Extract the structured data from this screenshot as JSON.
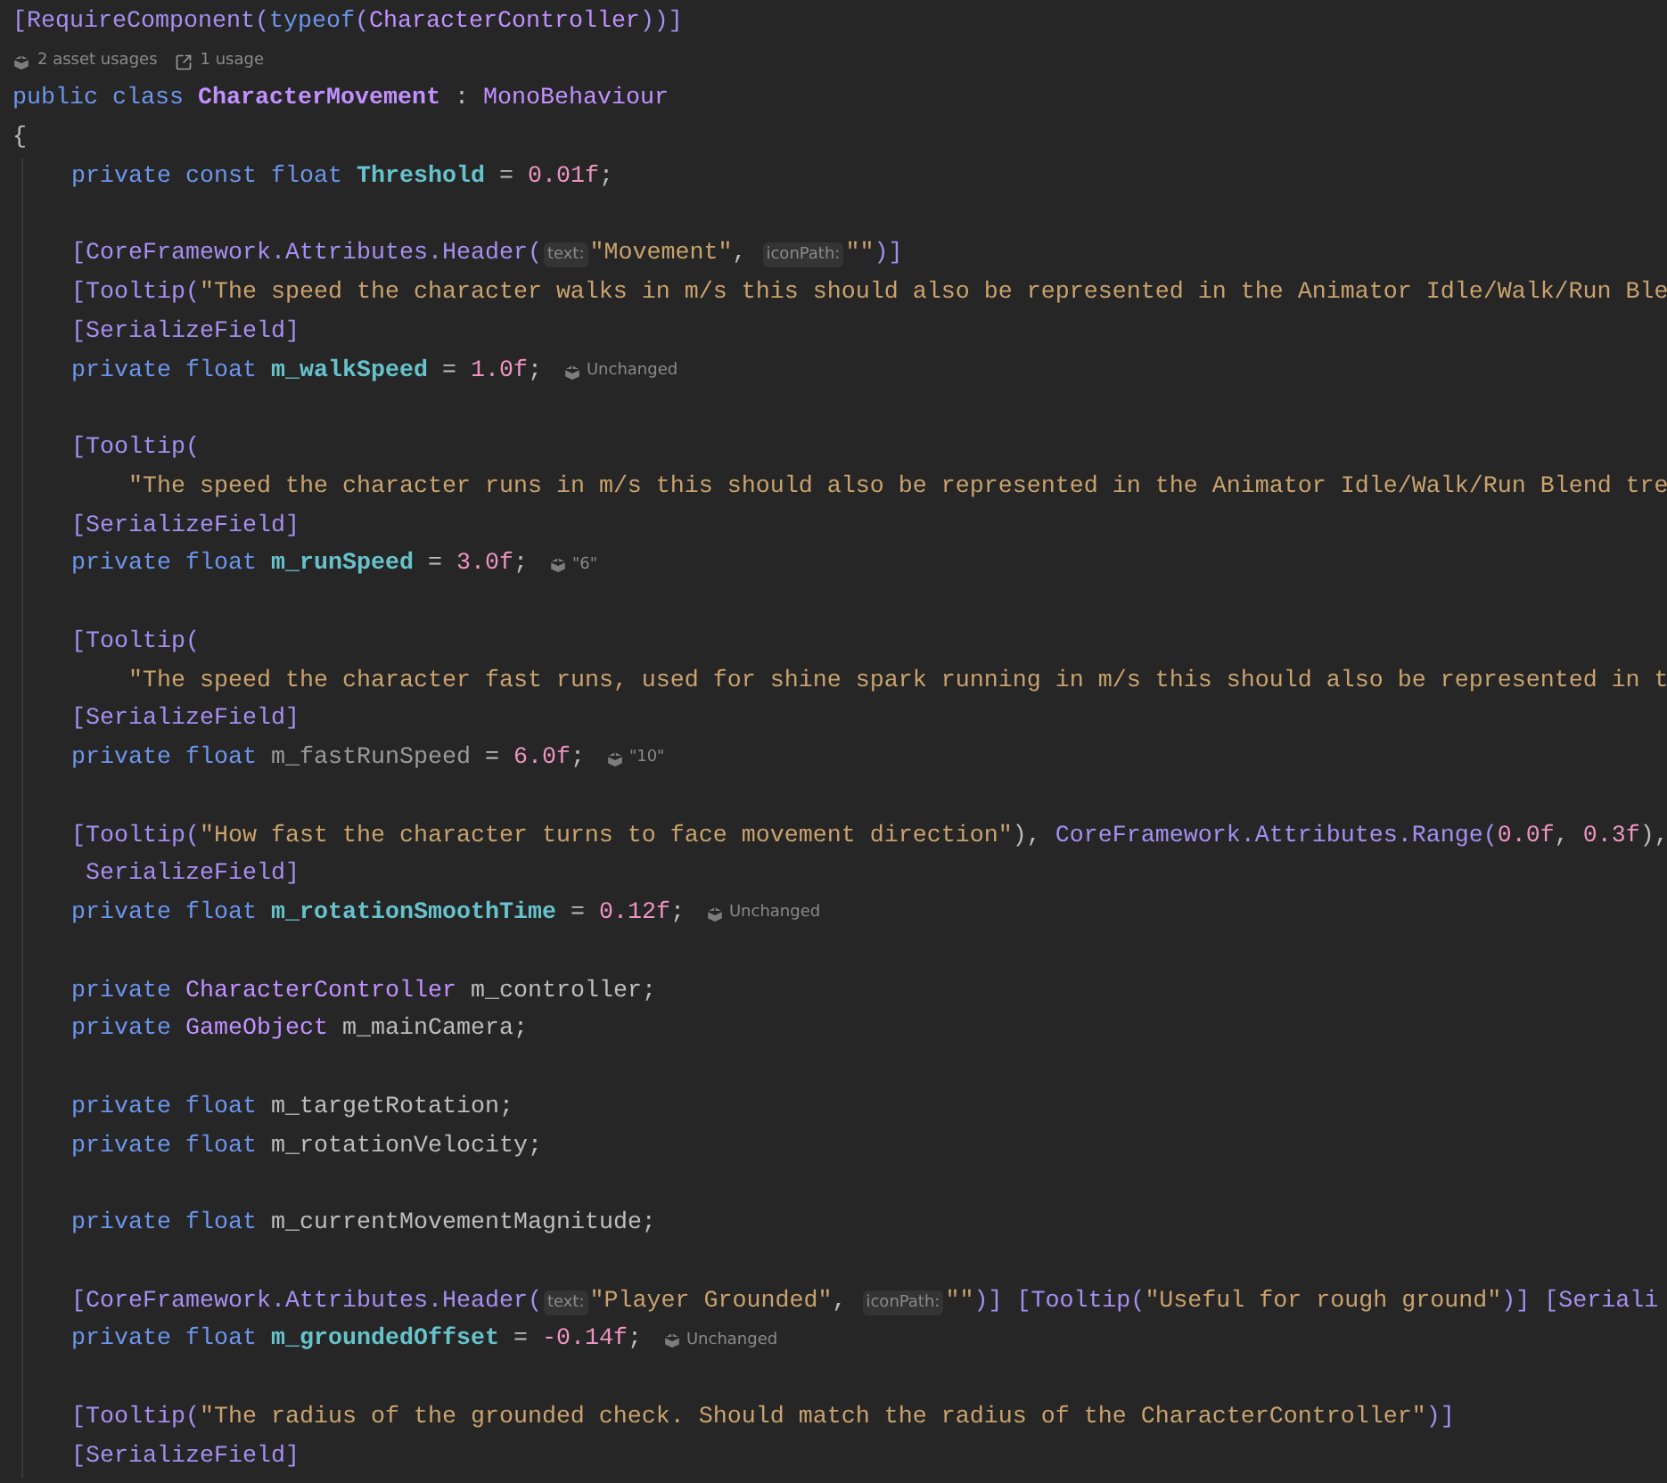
{
  "editor": {
    "lines": [
      {
        "kind": "code",
        "segments": [
          {
            "kind": "code",
            "tokens": [
              {
                "kind": "attr",
                "text": "[RequireComponent("
              },
              {
                "kind": "kw",
                "text": "typeof"
              },
              {
                "kind": "attr",
                "text": "("
              },
              {
                "kind": "type",
                "text": "CharacterController"
              },
              {
                "kind": "attr",
                "text": "))]"
              }
            ]
          }
        ]
      },
      {
        "kind": "code",
        "segments": [
          {
            "kind": "asset_usages",
            "text": "2 asset usages"
          },
          {
            "kind": "usages",
            "text": "1 usage"
          }
        ]
      },
      {
        "kind": "code",
        "segments": [
          {
            "kind": "code",
            "tokens": [
              {
                "kind": "kw",
                "text": "public class "
              },
              {
                "kind": "cls",
                "text": "CharacterMovement"
              },
              {
                "kind": "punct",
                "text": " : "
              },
              {
                "kind": "type",
                "text": "MonoBehaviour"
              }
            ]
          }
        ]
      },
      {
        "kind": "code",
        "segments": [
          {
            "kind": "code",
            "tokens": [
              {
                "kind": "punct",
                "text": "{"
              }
            ]
          }
        ],
        "children": [
          {
            "kind": "code",
            "segments": [
              {
                "kind": "code",
                "tokens": [
                  {
                    "kind": "kw",
                    "text": "private const float "
                  },
                  {
                    "kind": "field",
                    "text": "Threshold"
                  },
                  {
                    "kind": "punct",
                    "text": " = "
                  },
                  {
                    "kind": "num",
                    "text": "0.01f"
                  },
                  {
                    "kind": "punct",
                    "text": ";"
                  }
                ]
              }
            ]
          },
          {
            "kind": "blank"
          },
          {
            "kind": "code",
            "segments": [
              {
                "kind": "code",
                "tokens": [
                  {
                    "kind": "attr",
                    "text": "[CoreFramework.Attributes.Header("
                  }
                ]
              },
              {
                "kind": "hint",
                "text": "text:"
              },
              {
                "kind": "code",
                "tokens": [
                  {
                    "kind": "str",
                    "text": "\"Movement\""
                  },
                  {
                    "kind": "punct",
                    "text": ", "
                  }
                ]
              },
              {
                "kind": "hint",
                "text": "iconPath:"
              },
              {
                "kind": "code",
                "tokens": [
                  {
                    "kind": "str",
                    "text": "\"\""
                  },
                  {
                    "kind": "attr",
                    "text": ")]"
                  }
                ]
              }
            ]
          },
          {
            "kind": "code",
            "segments": [
              {
                "kind": "code",
                "tokens": [
                  {
                    "kind": "attr",
                    "text": "[Tooltip("
                  },
                  {
                    "kind": "str",
                    "text": "\"The speed the character walks in m/s this should also be represented in the Animator Idle/Walk/Run Ble"
                  }
                ]
              }
            ]
          },
          {
            "kind": "code",
            "segments": [
              {
                "kind": "code",
                "tokens": [
                  {
                    "kind": "attr",
                    "text": "[SerializeField]"
                  }
                ]
              }
            ]
          },
          {
            "kind": "code",
            "segments": [
              {
                "kind": "code",
                "tokens": [
                  {
                    "kind": "kw",
                    "text": "private float "
                  },
                  {
                    "kind": "field",
                    "text": "m_walkSpeed"
                  },
                  {
                    "kind": "punct",
                    "text": " = "
                  },
                  {
                    "kind": "num",
                    "text": "1.0f"
                  },
                  {
                    "kind": "punct",
                    "text": ";"
                  }
                ]
              },
              {
                "kind": "inlay",
                "text": "Unchanged"
              }
            ]
          },
          {
            "kind": "blank"
          },
          {
            "kind": "code",
            "segments": [
              {
                "kind": "code",
                "tokens": [
                  {
                    "kind": "attr",
                    "text": "[Tooltip("
                  }
                ]
              }
            ],
            "children": [
              {
                "kind": "code",
                "segments": [
                  {
                    "kind": "code",
                    "tokens": [
                      {
                        "kind": "str",
                        "text": "\"The speed the character runs in m/s this should also be represented in the Animator Idle/Walk/Run Blend tre"
                      }
                    ]
                  }
                ]
              }
            ]
          },
          {
            "kind": "code",
            "segments": [
              {
                "kind": "code",
                "tokens": [
                  {
                    "kind": "attr",
                    "text": "[SerializeField]"
                  }
                ]
              }
            ]
          },
          {
            "kind": "code",
            "segments": [
              {
                "kind": "code",
                "tokens": [
                  {
                    "kind": "kw",
                    "text": "private float "
                  },
                  {
                    "kind": "field",
                    "text": "m_runSpeed"
                  },
                  {
                    "kind": "punct",
                    "text": " = "
                  },
                  {
                    "kind": "num",
                    "text": "3.0f"
                  },
                  {
                    "kind": "punct",
                    "text": ";"
                  }
                ]
              },
              {
                "kind": "inlay",
                "text": "\"6\""
              }
            ]
          },
          {
            "kind": "blank"
          },
          {
            "kind": "code",
            "segments": [
              {
                "kind": "code",
                "tokens": [
                  {
                    "kind": "attr",
                    "text": "[Tooltip("
                  }
                ]
              }
            ],
            "children": [
              {
                "kind": "code",
                "segments": [
                  {
                    "kind": "code",
                    "tokens": [
                      {
                        "kind": "str",
                        "text": "\"The speed the character fast runs, used for shine spark running in m/s this should also be represented in t"
                      }
                    ]
                  }
                ]
              }
            ]
          },
          {
            "kind": "code",
            "segments": [
              {
                "kind": "code",
                "tokens": [
                  {
                    "kind": "attr",
                    "text": "[SerializeField]"
                  }
                ]
              }
            ]
          },
          {
            "kind": "code",
            "segments": [
              {
                "kind": "code",
                "tokens": [
                  {
                    "kind": "kw",
                    "text": "private float "
                  },
                  {
                    "kind": "unused",
                    "text": "m_fastRunSpeed"
                  },
                  {
                    "kind": "punct",
                    "text": " = "
                  },
                  {
                    "kind": "num",
                    "text": "6.0f"
                  },
                  {
                    "kind": "punct",
                    "text": ";"
                  }
                ]
              },
              {
                "kind": "inlay",
                "text": "\"10\""
              }
            ]
          },
          {
            "kind": "blank"
          },
          {
            "kind": "code",
            "segments": [
              {
                "kind": "code",
                "tokens": [
                  {
                    "kind": "attr",
                    "text": "[Tooltip("
                  },
                  {
                    "kind": "str",
                    "text": "\"How fast the character turns to face movement direction\""
                  },
                  {
                    "kind": "punct",
                    "text": "), "
                  },
                  {
                    "kind": "attr",
                    "text": "CoreFramework.Attributes.Range("
                  },
                  {
                    "kind": "num",
                    "text": "0.0f"
                  },
                  {
                    "kind": "punct",
                    "text": ", "
                  },
                  {
                    "kind": "num",
                    "text": "0.3f"
                  },
                  {
                    "kind": "punct",
                    "text": "),"
                  }
                ]
              }
            ]
          },
          {
            "kind": "code",
            "segments": [
              {
                "kind": "code",
                "tokens": [
                  {
                    "kind": "attr",
                    "text": " SerializeField]"
                  }
                ]
              }
            ]
          },
          {
            "kind": "code",
            "segments": [
              {
                "kind": "code",
                "tokens": [
                  {
                    "kind": "kw",
                    "text": "private float "
                  },
                  {
                    "kind": "field",
                    "text": "m_rotationSmoothTime"
                  },
                  {
                    "kind": "punct",
                    "text": " = "
                  },
                  {
                    "kind": "num",
                    "text": "0.12f"
                  },
                  {
                    "kind": "punct",
                    "text": ";"
                  }
                ]
              },
              {
                "kind": "inlay",
                "text": "Unchanged"
              }
            ]
          },
          {
            "kind": "blank"
          },
          {
            "kind": "code",
            "segments": [
              {
                "kind": "code",
                "tokens": [
                  {
                    "kind": "kw",
                    "text": "private "
                  },
                  {
                    "kind": "type",
                    "text": "CharacterController"
                  },
                  {
                    "kind": "punct",
                    "text": " m_controller;"
                  }
                ]
              }
            ]
          },
          {
            "kind": "code",
            "segments": [
              {
                "kind": "code",
                "tokens": [
                  {
                    "kind": "kw",
                    "text": "private "
                  },
                  {
                    "kind": "type",
                    "text": "GameObject"
                  },
                  {
                    "kind": "punct",
                    "text": " m_mainCamera;"
                  }
                ]
              }
            ]
          },
          {
            "kind": "blank"
          },
          {
            "kind": "code",
            "segments": [
              {
                "kind": "code",
                "tokens": [
                  {
                    "kind": "kw",
                    "text": "private float "
                  },
                  {
                    "kind": "punct",
                    "text": "m_targetRotation;"
                  }
                ]
              }
            ]
          },
          {
            "kind": "code",
            "segments": [
              {
                "kind": "code",
                "tokens": [
                  {
                    "kind": "kw",
                    "text": "private float "
                  },
                  {
                    "kind": "punct",
                    "text": "m_rotationVelocity;"
                  }
                ]
              }
            ]
          },
          {
            "kind": "blank"
          },
          {
            "kind": "code",
            "segments": [
              {
                "kind": "code",
                "tokens": [
                  {
                    "kind": "kw",
                    "text": "private float "
                  },
                  {
                    "kind": "punct",
                    "text": "m_currentMovementMagnitude;"
                  }
                ]
              }
            ]
          },
          {
            "kind": "blank"
          },
          {
            "kind": "code",
            "segments": [
              {
                "kind": "code",
                "tokens": [
                  {
                    "kind": "attr",
                    "text": "[CoreFramework.Attributes.Header("
                  }
                ]
              },
              {
                "kind": "hint",
                "text": "text:"
              },
              {
                "kind": "code",
                "tokens": [
                  {
                    "kind": "str",
                    "text": "\"Player Grounded\""
                  },
                  {
                    "kind": "punct",
                    "text": ", "
                  }
                ]
              },
              {
                "kind": "hint",
                "text": "iconPath:"
              },
              {
                "kind": "code",
                "tokens": [
                  {
                    "kind": "str",
                    "text": "\"\""
                  },
                  {
                    "kind": "attr",
                    "text": ")] [Tooltip("
                  },
                  {
                    "kind": "str",
                    "text": "\"Useful for rough ground\""
                  },
                  {
                    "kind": "attr",
                    "text": ")] [Seriali"
                  }
                ]
              }
            ]
          },
          {
            "kind": "code",
            "segments": [
              {
                "kind": "code",
                "tokens": [
                  {
                    "kind": "kw",
                    "text": "private float "
                  },
                  {
                    "kind": "field",
                    "text": "m_groundedOffset"
                  },
                  {
                    "kind": "punct",
                    "text": " = "
                  },
                  {
                    "kind": "num",
                    "text": "-0.14f"
                  },
                  {
                    "kind": "punct",
                    "text": ";"
                  }
                ]
              },
              {
                "kind": "inlay",
                "text": "Unchanged"
              }
            ]
          },
          {
            "kind": "blank"
          },
          {
            "kind": "code",
            "segments": [
              {
                "kind": "code",
                "tokens": [
                  {
                    "kind": "attr",
                    "text": "[Tooltip("
                  },
                  {
                    "kind": "str",
                    "text": "\"The radius of the grounded check. Should match the radius of the CharacterController\""
                  },
                  {
                    "kind": "attr",
                    "text": ")]"
                  }
                ]
              }
            ]
          },
          {
            "kind": "code",
            "segments": [
              {
                "kind": "code",
                "tokens": [
                  {
                    "kind": "attr",
                    "text": "[SerializeField]"
                  }
                ]
              }
            ]
          }
        ]
      }
    ]
  }
}
